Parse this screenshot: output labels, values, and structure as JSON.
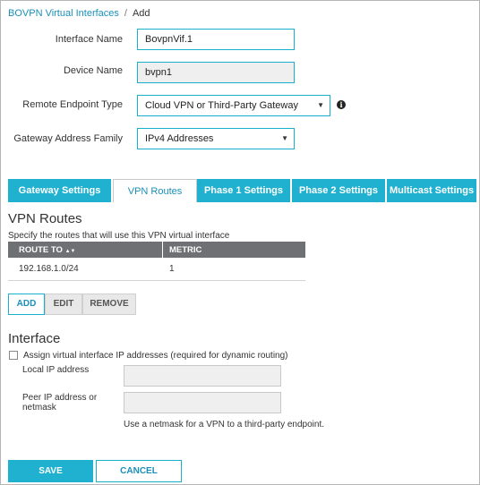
{
  "breadcrumb": {
    "parent": "BOVPN Virtual Interfaces",
    "separator": "/",
    "current": "Add"
  },
  "form": {
    "interface_name": {
      "label": "Interface Name",
      "value": "BovpnVif.1"
    },
    "device_name": {
      "label": "Device Name",
      "value": "bvpn1"
    },
    "remote_endpoint_type": {
      "label": "Remote Endpoint Type",
      "value": "Cloud VPN or Third-Party Gateway"
    },
    "gateway_address_family": {
      "label": "Gateway Address Family",
      "value": "IPv4 Addresses"
    }
  },
  "icons": {
    "caret": "▼",
    "info": "i",
    "sort": "▲▼"
  },
  "tabs": [
    {
      "label": "Gateway Settings",
      "active": false
    },
    {
      "label": "VPN Routes",
      "active": true
    },
    {
      "label": "Phase 1 Settings",
      "active": false
    },
    {
      "label": "Phase 2 Settings",
      "active": false
    },
    {
      "label": "Multicast Settings",
      "active": false
    }
  ],
  "vpn_routes": {
    "title": "VPN Routes",
    "description": "Specify the routes that will use this VPN virtual interface",
    "columns": [
      "ROUTE TO",
      "METRIC"
    ],
    "rows": [
      {
        "route_to": "192.168.1.0/24",
        "metric": "1"
      }
    ],
    "buttons": {
      "add": "ADD",
      "edit": "EDIT",
      "remove": "REMOVE"
    }
  },
  "interface": {
    "title": "Interface",
    "assign_label": "Assign virtual interface IP addresses (required for dynamic routing)",
    "assign_checked": false,
    "local_ip_label": "Local IP address",
    "local_ip_value": "",
    "peer_ip_label_line1": "Peer IP address or",
    "peer_ip_label_line2": "netmask",
    "peer_ip_value": "",
    "hint": "Use a netmask for a VPN to a third-party endpoint."
  },
  "footer": {
    "save": "SAVE",
    "cancel": "CANCEL"
  },
  "colors": {
    "accent": "#1fb1cf",
    "link": "#1a8fb8",
    "header": "#6e7073"
  }
}
